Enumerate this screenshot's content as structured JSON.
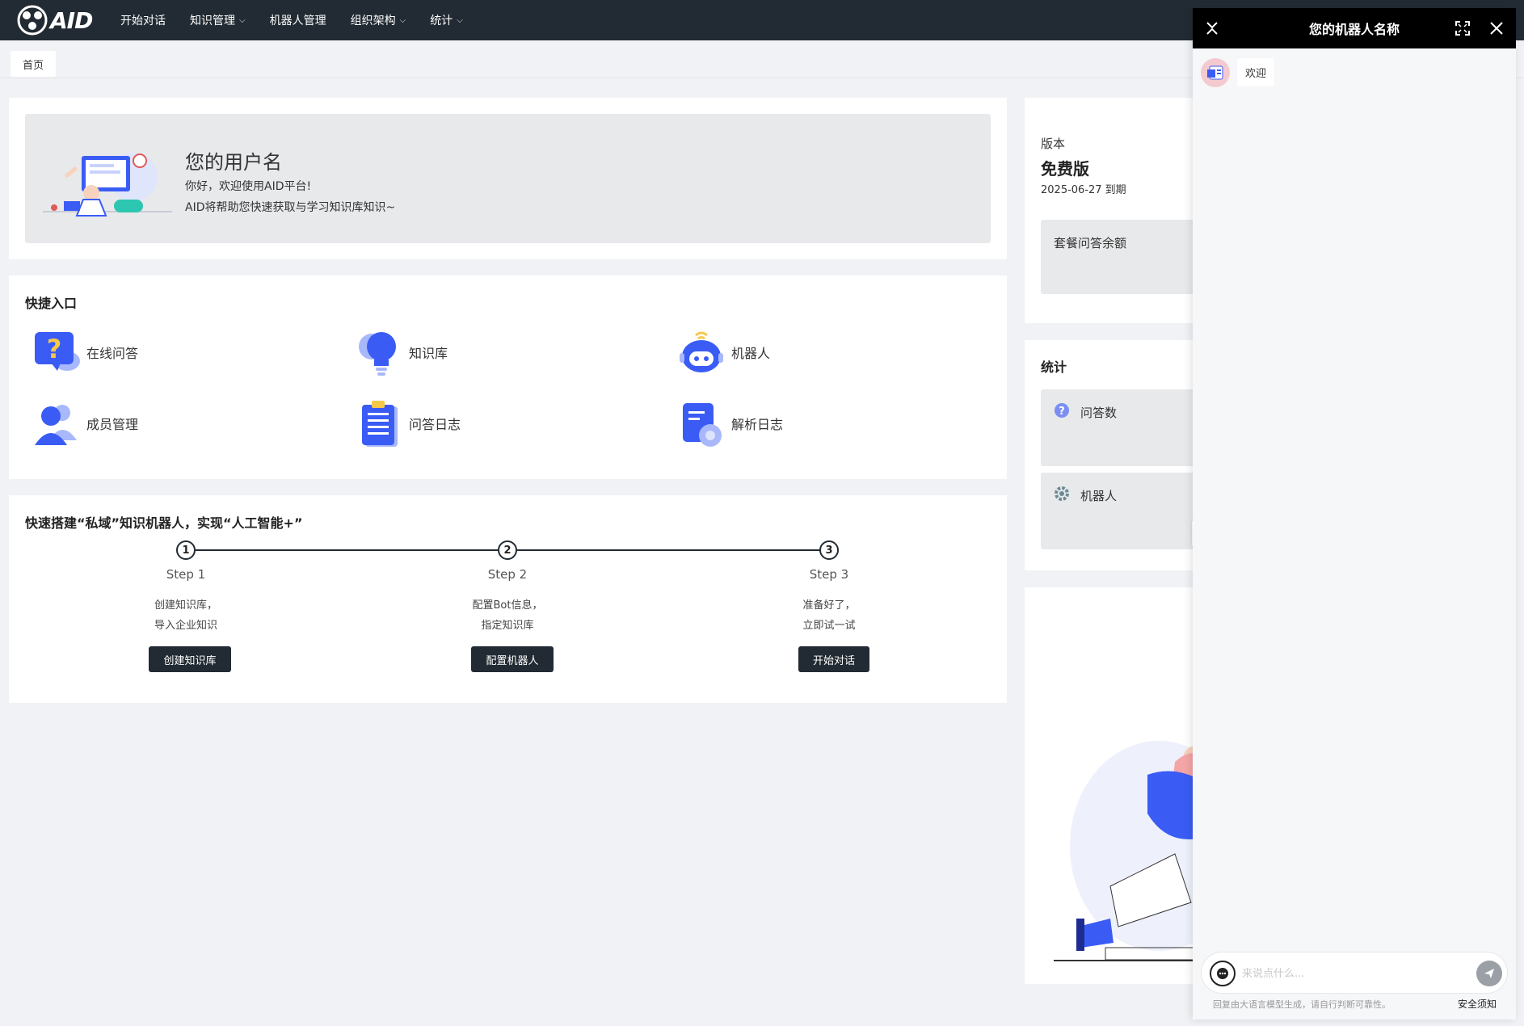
{
  "nav": {
    "logo_text": "AID",
    "items": [
      {
        "label": "开始对话",
        "has_dropdown": false
      },
      {
        "label": "知识管理",
        "has_dropdown": true
      },
      {
        "label": "机器人管理",
        "has_dropdown": false
      },
      {
        "label": "组织架构",
        "has_dropdown": true
      },
      {
        "label": "统计",
        "has_dropdown": true
      }
    ]
  },
  "tags": {
    "home": "首页"
  },
  "welcome": {
    "username": "您的用户名",
    "line1": "你好，欢迎使用AID平台!",
    "line2": "AID将帮助您快速获取与学习知识库知识~"
  },
  "quick": {
    "title": "快捷入口",
    "items": [
      {
        "label": "在线问答",
        "icon": "question-chat-icon"
      },
      {
        "label": "知识库",
        "icon": "lightbulb-icon"
      },
      {
        "label": "机器人",
        "icon": "robot-icon"
      },
      {
        "label": "成员管理",
        "icon": "members-icon"
      },
      {
        "label": "问答日志",
        "icon": "clipboard-log-icon"
      },
      {
        "label": "解析日志",
        "icon": "document-log-icon"
      }
    ]
  },
  "steps": {
    "title": "快速搭建“私域”知识机器人，实现“人工智能+”",
    "items": [
      {
        "num": "1",
        "name": "Step 1",
        "desc1": "创建知识库，",
        "desc2": "导入企业知识",
        "button": "创建知识库"
      },
      {
        "num": "2",
        "name": "Step 2",
        "desc1": "配置Bot信息，",
        "desc2": "指定知识库",
        "button": "配置机器人"
      },
      {
        "num": "3",
        "name": "Step 3",
        "desc1": "准备好了，",
        "desc2": "立即试一试",
        "button": "开始对话"
      }
    ]
  },
  "plan": {
    "label": "版本",
    "name": "免费版",
    "expiry": "2025-06-27 到期",
    "quota_label": "套餐问答余额"
  },
  "stats": {
    "title": "统计",
    "questions_label": "问答数",
    "robots_label": "机器人"
  },
  "chat": {
    "title": "您的机器人名称",
    "welcome_message": "欢迎",
    "input_placeholder": "来说点什么...",
    "disclaimer": "回复由大语言模型生成，请自行判断可靠性。",
    "safety_link": "安全须知"
  },
  "colors": {
    "nav_bg": "#222b33",
    "accent_blue": "#3a5cf5",
    "chat_header": "#000000"
  }
}
